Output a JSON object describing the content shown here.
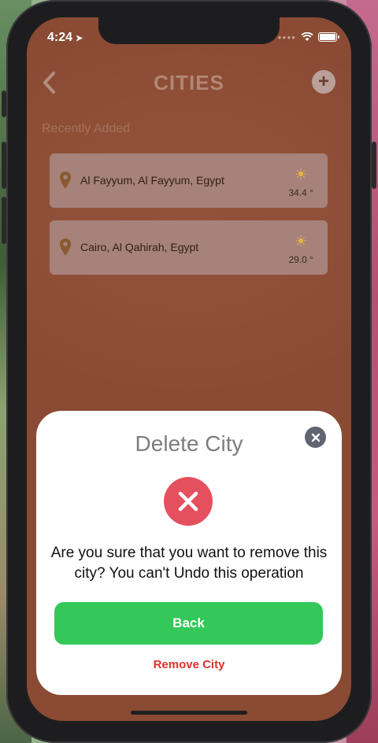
{
  "status_bar": {
    "time": "4:24",
    "location_icon": "location-arrow-icon",
    "signal_icon": "cellular-signal-icon",
    "wifi_icon": "wifi-icon",
    "battery_icon": "battery-icon"
  },
  "nav": {
    "title": "CITIES",
    "back_icon": "chevron-left-icon",
    "add_icon": "plus-icon",
    "add_label": "+"
  },
  "section": {
    "label": "Recently Added"
  },
  "cities": [
    {
      "name": "Al Fayyum, Al Fayyum, Egypt",
      "temperature": "34.4 °",
      "weather_icon": "sun-icon",
      "pin_icon": "map-pin-icon"
    },
    {
      "name": "Cairo, Al Qahirah, Egypt",
      "temperature": "29.0 °",
      "weather_icon": "sun-icon",
      "pin_icon": "map-pin-icon"
    }
  ],
  "modal": {
    "title": "Delete City",
    "close_icon": "close-icon",
    "status_icon": "error-x-icon",
    "message": "Are you sure that you want to remove this city? You can't Undo this operation",
    "primary_button": "Back",
    "secondary_action": "Remove City"
  },
  "colors": {
    "screen_background": "#8f4f37",
    "primary_green": "#34c759",
    "danger_red": "#e0302a",
    "error_circle": "#e5505f",
    "card_background": "#a6827b"
  }
}
